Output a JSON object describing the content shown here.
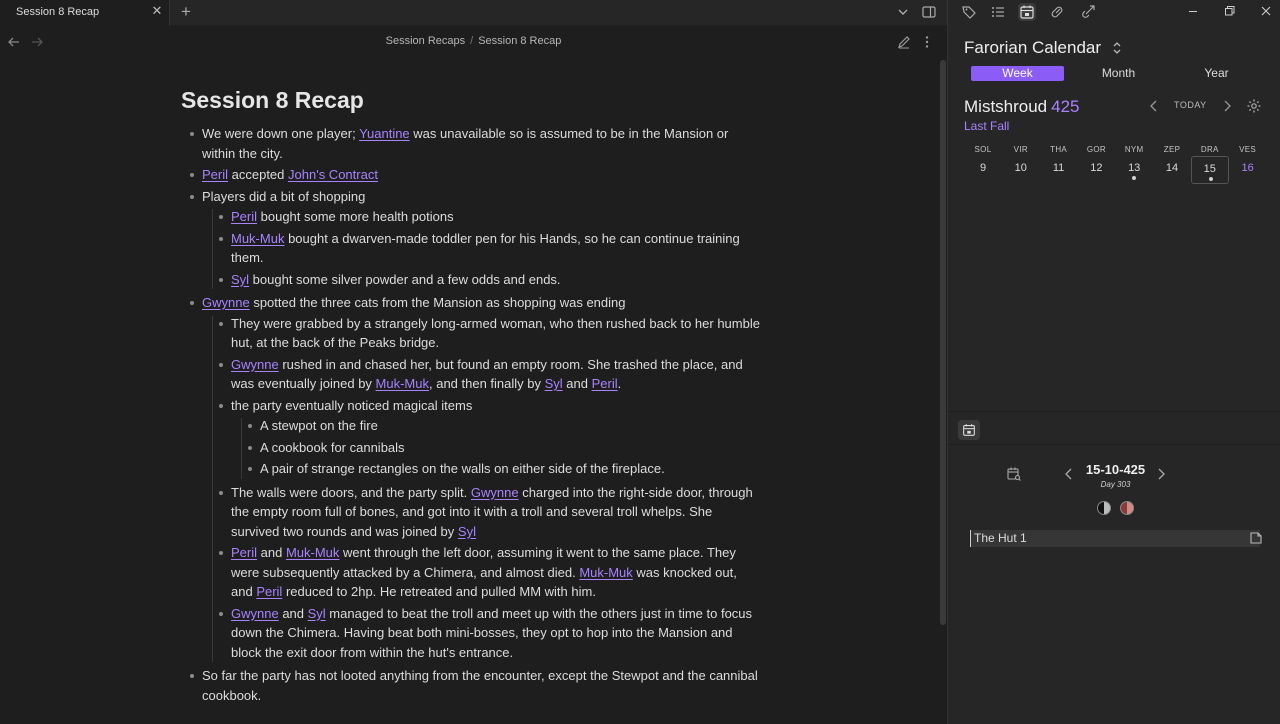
{
  "tab": {
    "title": "Session 8 Recap",
    "close": "✕",
    "new": "+"
  },
  "breadcrumb": {
    "folder": "Session Recaps",
    "sep": "/",
    "note": "Session 8 Recap"
  },
  "note": {
    "title": "Session 8 Recap",
    "b1": {
      "t1": "We were down one player; ",
      "l1": "Yuantine",
      "t2": " was unavailable so is assumed to be in the Mansion or within the city."
    },
    "b2": {
      "l1": "Peril",
      "t1": " accepted ",
      "l2": "John's Contract"
    },
    "b3": {
      "text": "Players did a bit of shopping",
      "s1": {
        "l1": "Peril",
        "t1": " bought some more health potions"
      },
      "s2": {
        "l1": "Muk-Muk",
        "t1": " bought a dwarven-made toddler pen for his Hands, so he can continue training them."
      },
      "s3": {
        "l1": "Syl",
        "t1": " bought some silver powder and a few odds and ends."
      }
    },
    "b4": {
      "l1": "Gwynne",
      "t1": " spotted the three cats from the Mansion as shopping was ending",
      "s1": "They were grabbed by a strangely long-armed woman, who then rushed back to her humble hut, at the back of the Peaks bridge.",
      "s2": {
        "l1": "Gwynne",
        "t1": " rushed in and chased her, but found an empty room. She trashed the place, and was eventually joined by ",
        "l2": "Muk-Muk",
        "t2": ", and then finally by ",
        "l3": "Syl",
        "t3": " and ",
        "l4": "Peril",
        "t4": "."
      },
      "s3": {
        "text": "the party eventually noticed magical items",
        "items": [
          "A stewpot on the fire",
          "A cookbook for cannibals",
          "A pair of strange rectangles on the walls on either side of the fireplace."
        ]
      },
      "s4": {
        "t1": "The walls were doors, and the party split. ",
        "l1": "Gwynne",
        "t2": " charged into the right-side door, through the empty room full of bones, and got into it with a troll and several troll whelps. She survived two rounds and was joined by ",
        "l2": "Syl"
      },
      "s5": {
        "l1": "Peril",
        "t1": " and ",
        "l2": "Muk-Muk",
        "t2": " went through the left door, assuming it went to the same place. They were subsequently attacked by a Chimera, and almost died. ",
        "l3": "Muk-Muk",
        "t3": " was knocked out, and ",
        "l4": "Peril",
        "t4": " reduced to 2hp. He retreated and pulled MM with him."
      },
      "s6": {
        "l1": "Gwynne",
        "t1": " and ",
        "l2": "Syl",
        "t2": " managed to beat the troll and meet up with the others just in time to focus down the Chimera. Having beat both mini-bosses, they opt to hop into the Mansion and block the exit door from within the hut's entrance."
      }
    },
    "b5": "So far the party has not looted anything from the encounter, except the Stewpot and the cannibal cookbook."
  },
  "calendar": {
    "title": "Farorian Calendar",
    "views": [
      "Week",
      "Month",
      "Year"
    ],
    "active_view": "Week",
    "month": "Mistshroud",
    "year": "425",
    "season": "Last Fall",
    "today_label": "TODAY",
    "weekdays": [
      "SOL",
      "VIR",
      "THA",
      "GOR",
      "NYM",
      "ZEP",
      "DRA",
      "VES"
    ],
    "days": [
      "9",
      "10",
      "11",
      "12",
      "13",
      "14",
      "15",
      "16"
    ],
    "today_day": "15",
    "highlight_day": "16",
    "event_days": [
      "13",
      "15"
    ]
  },
  "day_view": {
    "date": "15-10-425",
    "day_of_year": "Day 303",
    "event": "The Hut 1"
  },
  "colors": {
    "accent": "#a882ff",
    "active_view_bg": "#8b5cf6",
    "background": "#1e1e1e",
    "sidebar": "#262626"
  },
  "icons": [
    "back-arrow-icon",
    "forward-arrow-icon",
    "edit-icon",
    "more-options-icon",
    "chevron-down-icon",
    "sidebar-toggle-icon",
    "tags-icon",
    "list-icon",
    "calendar-icon",
    "link-icon",
    "outgoing-link-icon",
    "gear-icon",
    "moon-new-icon",
    "moon-red-icon",
    "note-icon"
  ]
}
